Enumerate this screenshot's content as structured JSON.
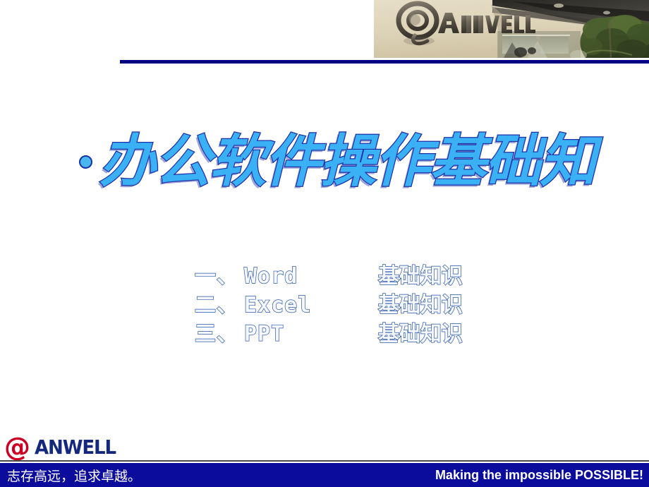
{
  "slide": {
    "title": "办公软件操作基础知",
    "bullet_icon": "bullet-dot-icon",
    "title_color": "#3ab0f5",
    "title_outline_color": "#1f2fa8"
  },
  "header": {
    "photo_alt": "anwell-office-sign-photo",
    "photo_sign_text": "@ANWELL",
    "rule_color": "#000080"
  },
  "agenda": {
    "items": [
      {
        "index": "一、",
        "app": "Word",
        "topic": "基础知识"
      },
      {
        "index": "二、",
        "app": "Excel",
        "topic": "基础知识"
      },
      {
        "index": "三、",
        "app": "PPT",
        "topic": "基础知识"
      }
    ],
    "text_outline_color": "#2b56a8"
  },
  "footer": {
    "logo": {
      "at_symbol": "@",
      "wordmark": "ANWELL",
      "at_color": "#cc0022",
      "wordmark_color": "#14297e"
    },
    "slogan_cn": "志存高远，追求卓越。",
    "slogan_en": "Making the impossible POSSIBLE!",
    "bar_color": "#0b0b9c"
  }
}
